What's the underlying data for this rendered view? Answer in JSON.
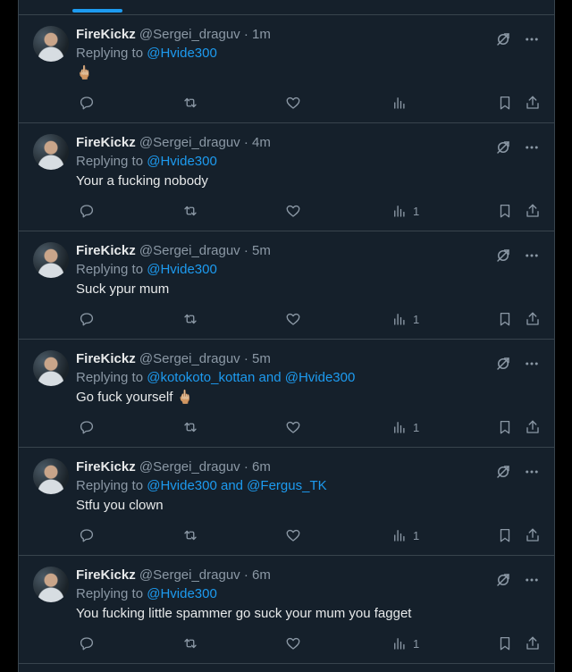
{
  "tweets": [
    {
      "name": "FireKickz",
      "handle": "@Sergei_draguv",
      "time": "· 1m",
      "replying_prefix": "Replying to ",
      "replying_to": "@Hvide300",
      "text": "🖕🏼",
      "views": ""
    },
    {
      "name": "FireKickz",
      "handle": "@Sergei_draguv",
      "time": "· 4m",
      "replying_prefix": "Replying to ",
      "replying_to": "@Hvide300",
      "text": "Your a fucking nobody",
      "views": "1"
    },
    {
      "name": "FireKickz",
      "handle": "@Sergei_draguv",
      "time": "· 5m",
      "replying_prefix": "Replying to ",
      "replying_to": "@Hvide300",
      "text": "Suck ypur mum",
      "views": "1"
    },
    {
      "name": "FireKickz",
      "handle": "@Sergei_draguv",
      "time": "· 5m",
      "replying_prefix": "Replying to ",
      "replying_to": "@kotokoto_kottan and @Hvide300",
      "text": "Go fuck yourself 🖕🏼",
      "views": "1"
    },
    {
      "name": "FireKickz",
      "handle": "@Sergei_draguv",
      "time": "· 6m",
      "replying_prefix": "Replying to ",
      "replying_to": "@Hvide300 and @Fergus_TK",
      "text": "Stfu you clown",
      "views": "1"
    },
    {
      "name": "FireKickz",
      "handle": "@Sergei_draguv",
      "time": "· 6m",
      "replying_prefix": "Replying to ",
      "replying_to": "@Hvide300",
      "text": "You fucking little spammer go suck your mum you fagget",
      "views": "1"
    }
  ],
  "icons": {
    "grok": "grok-icon",
    "more": "more-icon",
    "reply": "reply-icon",
    "repost": "repost-icon",
    "like": "like-icon",
    "views": "views-icon",
    "bookmark": "bookmark-icon",
    "share": "share-icon"
  },
  "colors": {
    "background": "#15202b",
    "accent": "#1d9bf0",
    "muted": "#8b98a5",
    "border": "#38444d"
  }
}
